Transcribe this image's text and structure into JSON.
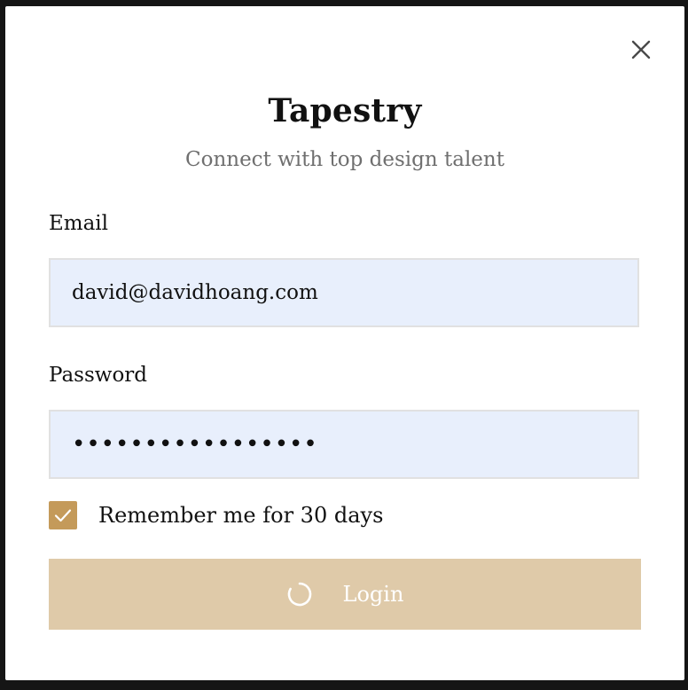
{
  "dialog": {
    "title": "Tapestry",
    "subtitle": "Connect with top design talent",
    "close_icon": "close-icon"
  },
  "form": {
    "email": {
      "label": "Email",
      "value": "david@davidhoang.com"
    },
    "password": {
      "label": "Password",
      "masked_value": "•••••••••••••••••"
    },
    "remember": {
      "checked": true,
      "label": "Remember me for 30 days"
    },
    "submit": {
      "label": "Login",
      "loading": true,
      "spinner_icon": "loading-spinner-icon"
    }
  },
  "colors": {
    "accent": "#c49a5a",
    "button_disabled": "#dfcaa9",
    "input_bg": "#e8effc",
    "subtitle": "#6f6f6f"
  }
}
